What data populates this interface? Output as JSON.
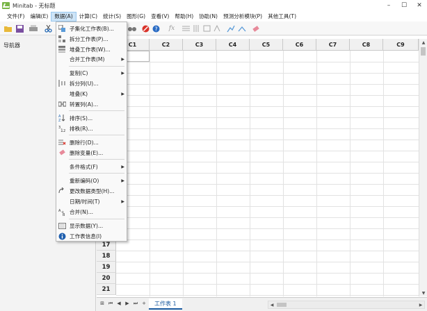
{
  "window": {
    "title": "Minitab - 无标题",
    "minimize": "–",
    "maximize": "☐",
    "close": "✕"
  },
  "menubar": {
    "items": [
      "文件(F)",
      "编辑(E)",
      "数据(A)",
      "计算(C)",
      "统计(S)",
      "图形(G)",
      "查看(V)",
      "帮助(H)",
      "协助(N)",
      "预测分析模块(P)",
      "其他工具(T)"
    ],
    "active_index": 2
  },
  "navigator": {
    "title": "导航器"
  },
  "worksheet": {
    "columns": [
      "C1",
      "C2",
      "C3",
      "C4",
      "C5",
      "C6",
      "C7",
      "C8",
      "C9"
    ],
    "visible_row_labels": [
      "17",
      "18",
      "19",
      "20",
      "21"
    ],
    "tab_label": "工作表 1",
    "tab_nav": [
      "⊞",
      "⏮",
      "◀",
      "▶",
      "⏭",
      "+"
    ]
  },
  "data_menu": {
    "items": [
      {
        "label": "子集化工作表(B)...",
        "icon": "subset-icon",
        "submenu": false
      },
      {
        "label": "拆分工作表(P)...",
        "icon": "split-worksheet-icon",
        "submenu": false
      },
      {
        "label": "堆叠工作表(W)...",
        "icon": "stack-worksheets-icon",
        "submenu": false
      },
      {
        "label": "合并工作表(M)",
        "icon": "",
        "submenu": true
      },
      {
        "label": "复制(C)",
        "icon": "",
        "submenu": true
      },
      {
        "label": "拆分列(U)...",
        "icon": "split-column-icon",
        "submenu": false
      },
      {
        "label": "堆叠(K)",
        "icon": "",
        "submenu": true
      },
      {
        "label": "转置列(A)...",
        "icon": "transpose-icon",
        "submenu": false
      },
      {
        "label": "排序(S)...",
        "icon": "sort-icon",
        "submenu": false
      },
      {
        "label": "排秩(R)...",
        "icon": "rank-icon",
        "submenu": false
      },
      {
        "label": "删除行(D)...",
        "icon": "delete-rows-icon",
        "submenu": false
      },
      {
        "label": "删除变量(E)...",
        "icon": "eraser-icon",
        "submenu": false
      },
      {
        "label": "条件格式(F)",
        "icon": "",
        "submenu": true
      },
      {
        "label": "重新编码(O)",
        "icon": "",
        "submenu": true
      },
      {
        "label": "更改数据类型(H)...",
        "icon": "change-type-icon",
        "submenu": false
      },
      {
        "label": "日期/时间(T)",
        "icon": "",
        "submenu": true
      },
      {
        "label": "合并(N)...",
        "icon": "combine-icon",
        "submenu": false
      },
      {
        "label": "显示数据(Y)...",
        "icon": "display-data-icon",
        "submenu": false
      },
      {
        "label": "工作表信息(I)",
        "icon": "info-icon",
        "submenu": false
      }
    ]
  },
  "colors": {
    "accent": "#1a5aa0",
    "menu_highlight": "#cde4f7",
    "stop_red": "#d9342b",
    "help_blue": "#2b6cc4"
  }
}
